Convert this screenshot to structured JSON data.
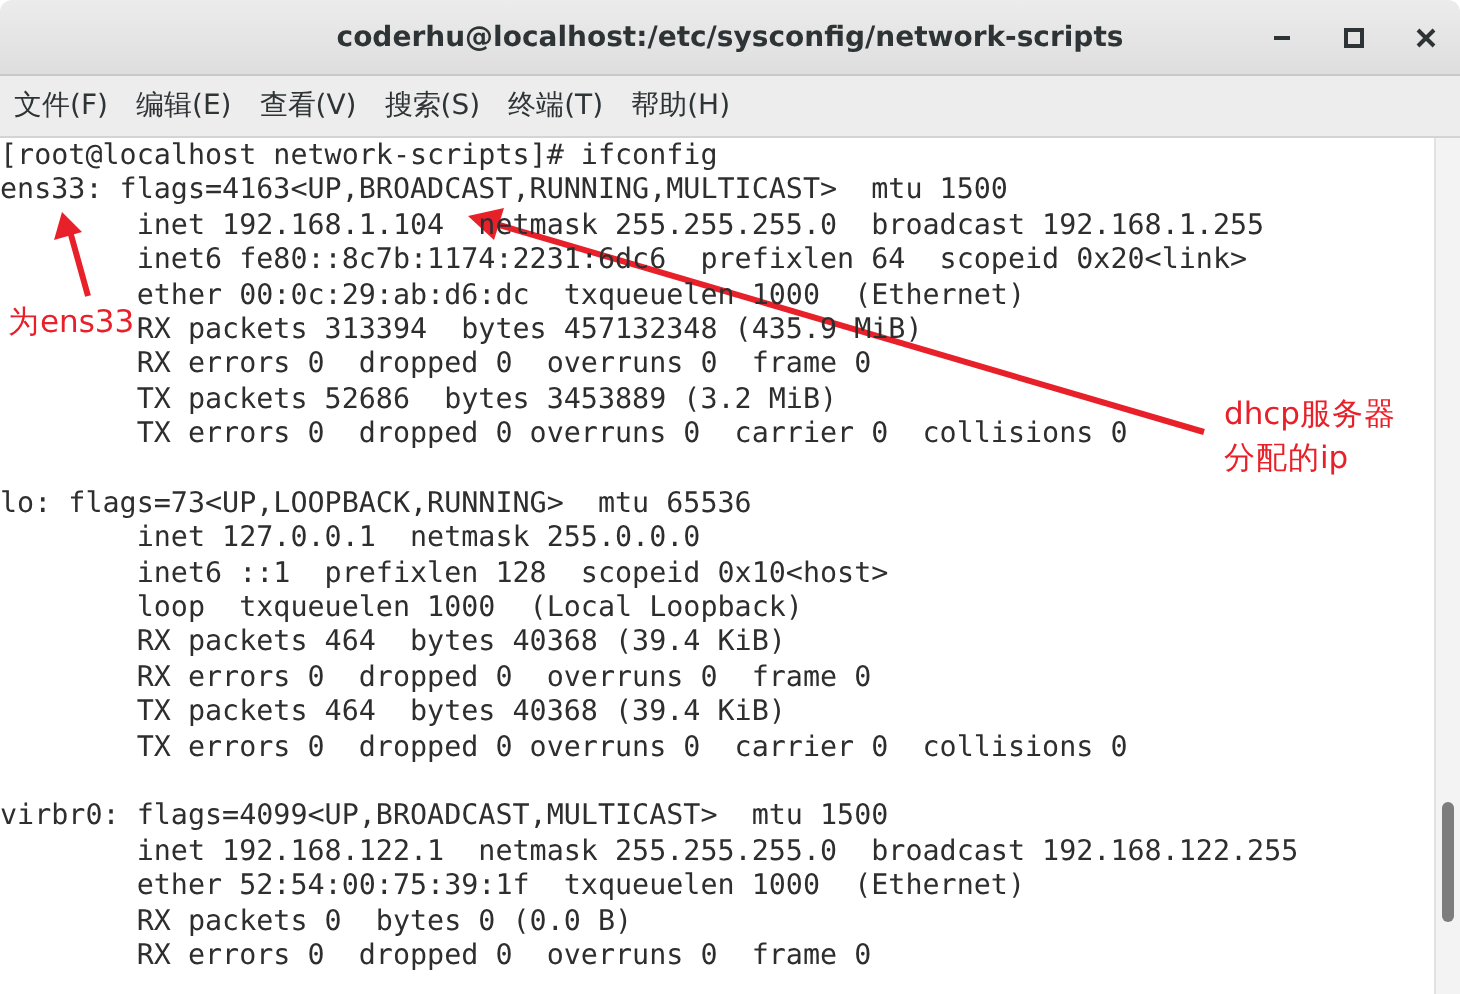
{
  "window": {
    "title": "coderhu@localhost:/etc/sysconfig/network-scripts"
  },
  "menu": [
    "文件(F)",
    "编辑(E)",
    "查看(V)",
    "搜索(S)",
    "终端(T)",
    "帮助(H)"
  ],
  "terminal": {
    "prompt": "[root@localhost network-scripts]# ifconfig",
    "blocks": [
      [
        "ens33: flags=4163<UP,BROADCAST,RUNNING,MULTICAST>  mtu 1500",
        "        inet 192.168.1.104  netmask 255.255.255.0  broadcast 192.168.1.255",
        "        inet6 fe80::8c7b:1174:2231:6dc6  prefixlen 64  scopeid 0x20<link>",
        "        ether 00:0c:29:ab:d6:dc  txqueuelen 1000  (Ethernet)",
        "        RX packets 313394  bytes 457132348 (435.9 MiB)",
        "        RX errors 0  dropped 0  overruns 0  frame 0",
        "        TX packets 52686  bytes 3453889 (3.2 MiB)",
        "        TX errors 0  dropped 0 overruns 0  carrier 0  collisions 0"
      ],
      [
        "lo: flags=73<UP,LOOPBACK,RUNNING>  mtu 65536",
        "        inet 127.0.0.1  netmask 255.0.0.0",
        "        inet6 ::1  prefixlen 128  scopeid 0x10<host>",
        "        loop  txqueuelen 1000  (Local Loopback)",
        "        RX packets 464  bytes 40368 (39.4 KiB)",
        "        RX errors 0  dropped 0  overruns 0  frame 0",
        "        TX packets 464  bytes 40368 (39.4 KiB)",
        "        TX errors 0  dropped 0 overruns 0  carrier 0  collisions 0"
      ],
      [
        "virbr0: flags=4099<UP,BROADCAST,MULTICAST>  mtu 1500",
        "        inet 192.168.122.1  netmask 255.255.255.0  broadcast 192.168.122.255",
        "        ether 52:54:00:75:39:1f  txqueuelen 1000  (Ethernet)",
        "        RX packets 0  bytes 0 (0.0 B)",
        "        RX errors 0  dropped 0  overruns 0  frame 0"
      ]
    ]
  },
  "annotations": [
    {
      "lines": [
        "为ens33"
      ]
    },
    {
      "lines": [
        "dhcp服务器",
        "分配的ip"
      ]
    }
  ]
}
